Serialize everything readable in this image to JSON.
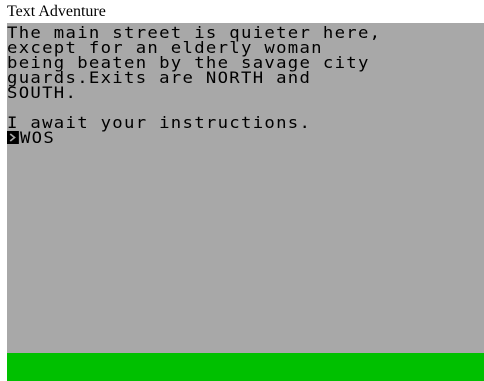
{
  "window": {
    "title": "Text Adventure"
  },
  "terminal": {
    "lines": [
      "The main street is quieter here,",
      "except for an elderly woman",
      "being beaten by the savage city",
      "guards.Exits are NORTH and",
      "SOUTH."
    ],
    "response": "I await your instructions.",
    "input_value": "WOS",
    "prompt_icon": "chevron-right-icon"
  },
  "colors": {
    "screen_background": "#a8a8a8",
    "text": "#000000",
    "status_bar": "#00c000"
  }
}
